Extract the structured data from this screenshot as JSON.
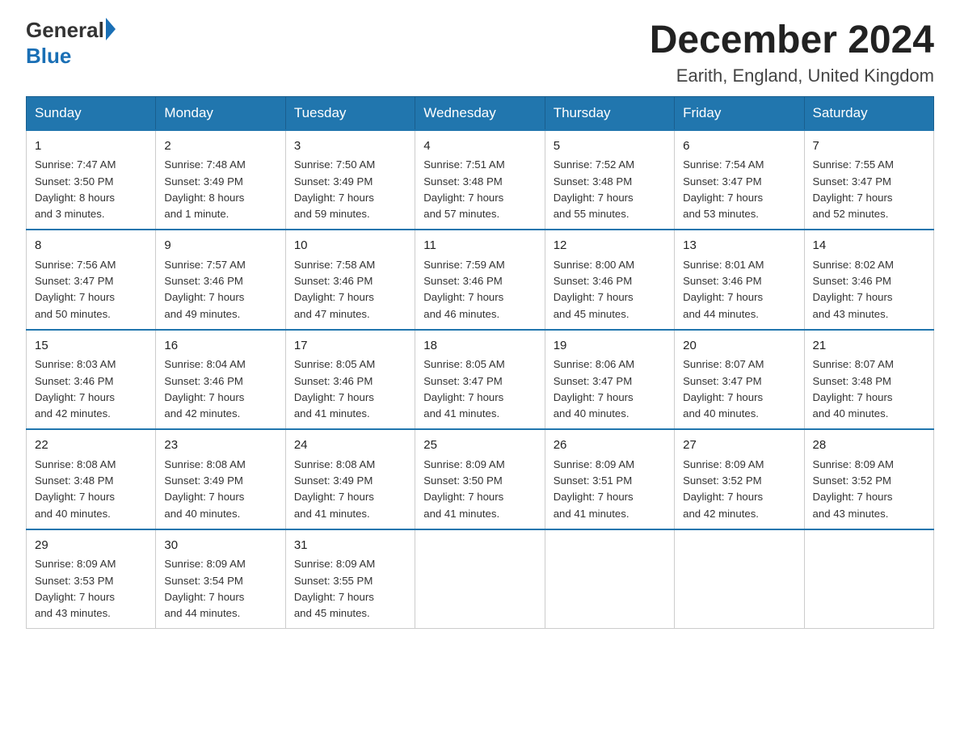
{
  "logo": {
    "general": "General",
    "blue": "Blue"
  },
  "title": "December 2024",
  "location": "Earith, England, United Kingdom",
  "days_of_week": [
    "Sunday",
    "Monday",
    "Tuesday",
    "Wednesday",
    "Thursday",
    "Friday",
    "Saturday"
  ],
  "weeks": [
    [
      {
        "day": 1,
        "info": "Sunrise: 7:47 AM\nSunset: 3:50 PM\nDaylight: 8 hours\nand 3 minutes."
      },
      {
        "day": 2,
        "info": "Sunrise: 7:48 AM\nSunset: 3:49 PM\nDaylight: 8 hours\nand 1 minute."
      },
      {
        "day": 3,
        "info": "Sunrise: 7:50 AM\nSunset: 3:49 PM\nDaylight: 7 hours\nand 59 minutes."
      },
      {
        "day": 4,
        "info": "Sunrise: 7:51 AM\nSunset: 3:48 PM\nDaylight: 7 hours\nand 57 minutes."
      },
      {
        "day": 5,
        "info": "Sunrise: 7:52 AM\nSunset: 3:48 PM\nDaylight: 7 hours\nand 55 minutes."
      },
      {
        "day": 6,
        "info": "Sunrise: 7:54 AM\nSunset: 3:47 PM\nDaylight: 7 hours\nand 53 minutes."
      },
      {
        "day": 7,
        "info": "Sunrise: 7:55 AM\nSunset: 3:47 PM\nDaylight: 7 hours\nand 52 minutes."
      }
    ],
    [
      {
        "day": 8,
        "info": "Sunrise: 7:56 AM\nSunset: 3:47 PM\nDaylight: 7 hours\nand 50 minutes."
      },
      {
        "day": 9,
        "info": "Sunrise: 7:57 AM\nSunset: 3:46 PM\nDaylight: 7 hours\nand 49 minutes."
      },
      {
        "day": 10,
        "info": "Sunrise: 7:58 AM\nSunset: 3:46 PM\nDaylight: 7 hours\nand 47 minutes."
      },
      {
        "day": 11,
        "info": "Sunrise: 7:59 AM\nSunset: 3:46 PM\nDaylight: 7 hours\nand 46 minutes."
      },
      {
        "day": 12,
        "info": "Sunrise: 8:00 AM\nSunset: 3:46 PM\nDaylight: 7 hours\nand 45 minutes."
      },
      {
        "day": 13,
        "info": "Sunrise: 8:01 AM\nSunset: 3:46 PM\nDaylight: 7 hours\nand 44 minutes."
      },
      {
        "day": 14,
        "info": "Sunrise: 8:02 AM\nSunset: 3:46 PM\nDaylight: 7 hours\nand 43 minutes."
      }
    ],
    [
      {
        "day": 15,
        "info": "Sunrise: 8:03 AM\nSunset: 3:46 PM\nDaylight: 7 hours\nand 42 minutes."
      },
      {
        "day": 16,
        "info": "Sunrise: 8:04 AM\nSunset: 3:46 PM\nDaylight: 7 hours\nand 42 minutes."
      },
      {
        "day": 17,
        "info": "Sunrise: 8:05 AM\nSunset: 3:46 PM\nDaylight: 7 hours\nand 41 minutes."
      },
      {
        "day": 18,
        "info": "Sunrise: 8:05 AM\nSunset: 3:47 PM\nDaylight: 7 hours\nand 41 minutes."
      },
      {
        "day": 19,
        "info": "Sunrise: 8:06 AM\nSunset: 3:47 PM\nDaylight: 7 hours\nand 40 minutes."
      },
      {
        "day": 20,
        "info": "Sunrise: 8:07 AM\nSunset: 3:47 PM\nDaylight: 7 hours\nand 40 minutes."
      },
      {
        "day": 21,
        "info": "Sunrise: 8:07 AM\nSunset: 3:48 PM\nDaylight: 7 hours\nand 40 minutes."
      }
    ],
    [
      {
        "day": 22,
        "info": "Sunrise: 8:08 AM\nSunset: 3:48 PM\nDaylight: 7 hours\nand 40 minutes."
      },
      {
        "day": 23,
        "info": "Sunrise: 8:08 AM\nSunset: 3:49 PM\nDaylight: 7 hours\nand 40 minutes."
      },
      {
        "day": 24,
        "info": "Sunrise: 8:08 AM\nSunset: 3:49 PM\nDaylight: 7 hours\nand 41 minutes."
      },
      {
        "day": 25,
        "info": "Sunrise: 8:09 AM\nSunset: 3:50 PM\nDaylight: 7 hours\nand 41 minutes."
      },
      {
        "day": 26,
        "info": "Sunrise: 8:09 AM\nSunset: 3:51 PM\nDaylight: 7 hours\nand 41 minutes."
      },
      {
        "day": 27,
        "info": "Sunrise: 8:09 AM\nSunset: 3:52 PM\nDaylight: 7 hours\nand 42 minutes."
      },
      {
        "day": 28,
        "info": "Sunrise: 8:09 AM\nSunset: 3:52 PM\nDaylight: 7 hours\nand 43 minutes."
      }
    ],
    [
      {
        "day": 29,
        "info": "Sunrise: 8:09 AM\nSunset: 3:53 PM\nDaylight: 7 hours\nand 43 minutes."
      },
      {
        "day": 30,
        "info": "Sunrise: 8:09 AM\nSunset: 3:54 PM\nDaylight: 7 hours\nand 44 minutes."
      },
      {
        "day": 31,
        "info": "Sunrise: 8:09 AM\nSunset: 3:55 PM\nDaylight: 7 hours\nand 45 minutes."
      },
      null,
      null,
      null,
      null
    ]
  ]
}
